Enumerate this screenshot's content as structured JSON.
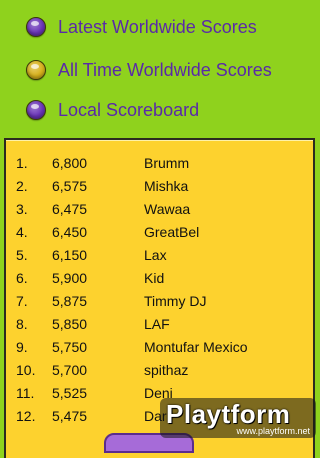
{
  "menu": {
    "items": [
      {
        "label": "Latest Worldwide Scores",
        "radio_color": "#6a34b8"
      },
      {
        "label": "All Time Worldwide Scores",
        "radio_color": "#d8b21c"
      },
      {
        "label": "Local Scoreboard",
        "radio_color": "#6a34b8"
      }
    ]
  },
  "scoreboard": {
    "rows": [
      {
        "rank": "1.",
        "score": "6,800",
        "name": "Brumm"
      },
      {
        "rank": "2.",
        "score": "6,575",
        "name": "Mishka"
      },
      {
        "rank": "3.",
        "score": "6,475",
        "name": "Wawaa"
      },
      {
        "rank": "4.",
        "score": "6,450",
        "name": "GreatBel"
      },
      {
        "rank": "5.",
        "score": "6,150",
        "name": "Lax"
      },
      {
        "rank": "6.",
        "score": "5,900",
        "name": "Kid"
      },
      {
        "rank": "7.",
        "score": "5,875",
        "name": "Timmy DJ"
      },
      {
        "rank": "8.",
        "score": "5,850",
        "name": "LAF"
      },
      {
        "rank": "9.",
        "score": "5,750",
        "name": "Montufar Mexico"
      },
      {
        "rank": "10.",
        "score": "5,700",
        "name": "spithaz"
      },
      {
        "rank": "11.",
        "score": "5,525",
        "name": "Deni"
      },
      {
        "rank": "12.",
        "score": "5,475",
        "name": "Dar"
      }
    ]
  },
  "watermark": {
    "logo": "Playtform",
    "url": "www.playtform.net"
  },
  "colors": {
    "background": "#8fd21d",
    "board": "#fdd22e",
    "menu_text": "#5a2aa8"
  }
}
